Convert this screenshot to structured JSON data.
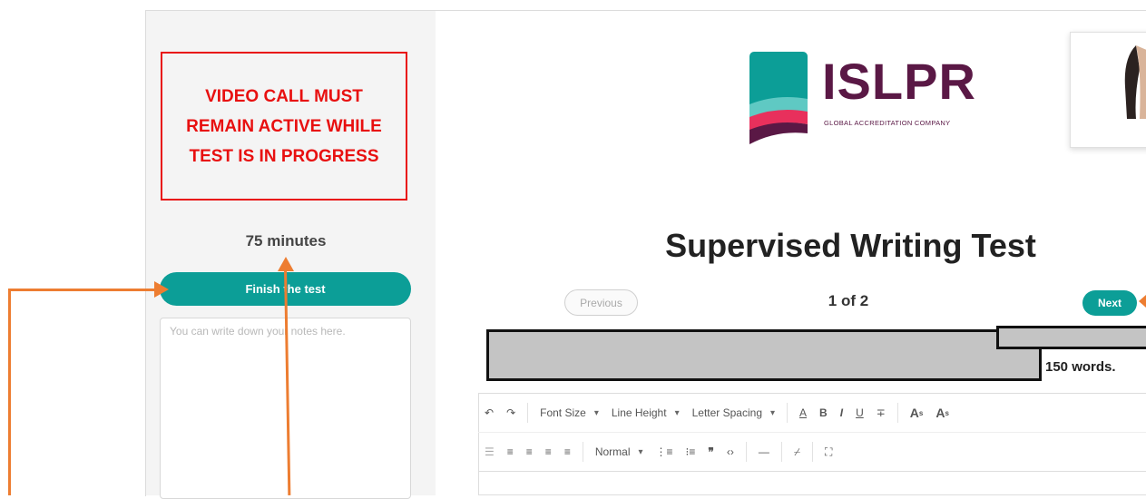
{
  "sidebar": {
    "warning": "VIDEO CALL MUST REMAIN ACTIVE WHILE TEST IS IN PROGRESS",
    "time": "75 minutes",
    "finish_label": "Finish the test",
    "notes_placeholder": "You can write down your notes here."
  },
  "brand": {
    "name": "ISLPR",
    "tagline": "GLOBAL ACCREDITATION COMPANY"
  },
  "main": {
    "title": "Supervised Writing Test",
    "prev_label": "Previous",
    "next_label": "Next",
    "pager": "1 of 2",
    "word_limit": "150 words."
  },
  "toolbar": {
    "font_size": "Font Size",
    "line_height": "Line Height",
    "letter_spacing": "Letter Spacing",
    "paragraph": "Normal",
    "bold": "B",
    "italic": "I",
    "underline": "U"
  },
  "colors": {
    "accent": "#0c9e97",
    "warning": "#e81010",
    "annotation": "#ed7d31",
    "brand": "#5a1845"
  }
}
